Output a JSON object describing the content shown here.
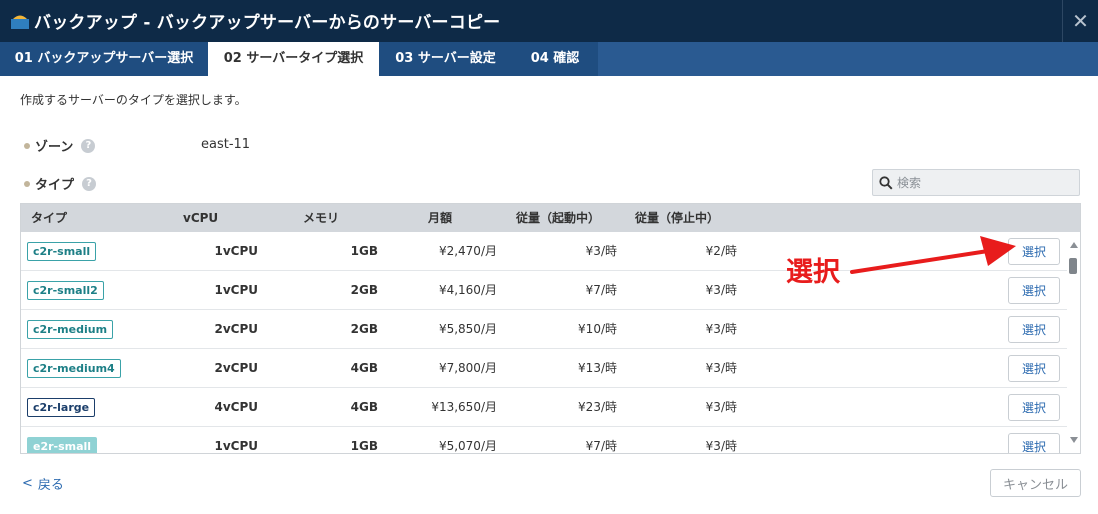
{
  "window": {
    "title": "バックアップ - バックアップサーバーからのサーバーコピー",
    "close_label": "✕"
  },
  "tabs": [
    {
      "label": "01 バックアップサーバー選択",
      "active": false
    },
    {
      "label": "02 サーバータイプ選択",
      "active": true
    },
    {
      "label": "03 サーバー設定",
      "active": false
    },
    {
      "label": "04 確認",
      "active": false
    }
  ],
  "description": "作成するサーバーのタイプを選択します。",
  "zone": {
    "label": "ゾーン",
    "value": "east-11",
    "help": "?"
  },
  "type_field": {
    "label": "タイプ",
    "help": "?"
  },
  "search": {
    "placeholder": "検索"
  },
  "table": {
    "headers": [
      "タイプ",
      "vCPU",
      "メモリ",
      "月額",
      "従量（起動中）",
      "従量（停止中）"
    ],
    "select_label": "選択",
    "rows": [
      {
        "type": "c2r-small",
        "vcpu": "1vCPU",
        "memory": "1GB",
        "monthly": "¥2,470/月",
        "running": "¥3/時",
        "stopped": "¥2/時",
        "style": "teal"
      },
      {
        "type": "c2r-small2",
        "vcpu": "1vCPU",
        "memory": "2GB",
        "monthly": "¥4,160/月",
        "running": "¥7/時",
        "stopped": "¥3/時",
        "style": "teal"
      },
      {
        "type": "c2r-medium",
        "vcpu": "2vCPU",
        "memory": "2GB",
        "monthly": "¥5,850/月",
        "running": "¥10/時",
        "stopped": "¥3/時",
        "style": "teal"
      },
      {
        "type": "c2r-medium4",
        "vcpu": "2vCPU",
        "memory": "4GB",
        "monthly": "¥7,800/月",
        "running": "¥13/時",
        "stopped": "¥3/時",
        "style": "teal"
      },
      {
        "type": "c2r-large",
        "vcpu": "4vCPU",
        "memory": "4GB",
        "monthly": "¥13,650/月",
        "running": "¥23/時",
        "stopped": "¥3/時",
        "style": "dark"
      },
      {
        "type": "e2r-small",
        "vcpu": "1vCPU",
        "memory": "1GB",
        "monthly": "¥5,070/月",
        "running": "¥7/時",
        "stopped": "¥3/時",
        "style": "filled"
      }
    ]
  },
  "annotation": {
    "text": "選択",
    "color": "#e81c1c"
  },
  "footer": {
    "back_label": "戻る",
    "cancel_label": "キャンセル"
  },
  "colors": {
    "titlebar": "#0e2a47",
    "tabbar": "#2a5a91",
    "accent": "#2d6bb0"
  }
}
